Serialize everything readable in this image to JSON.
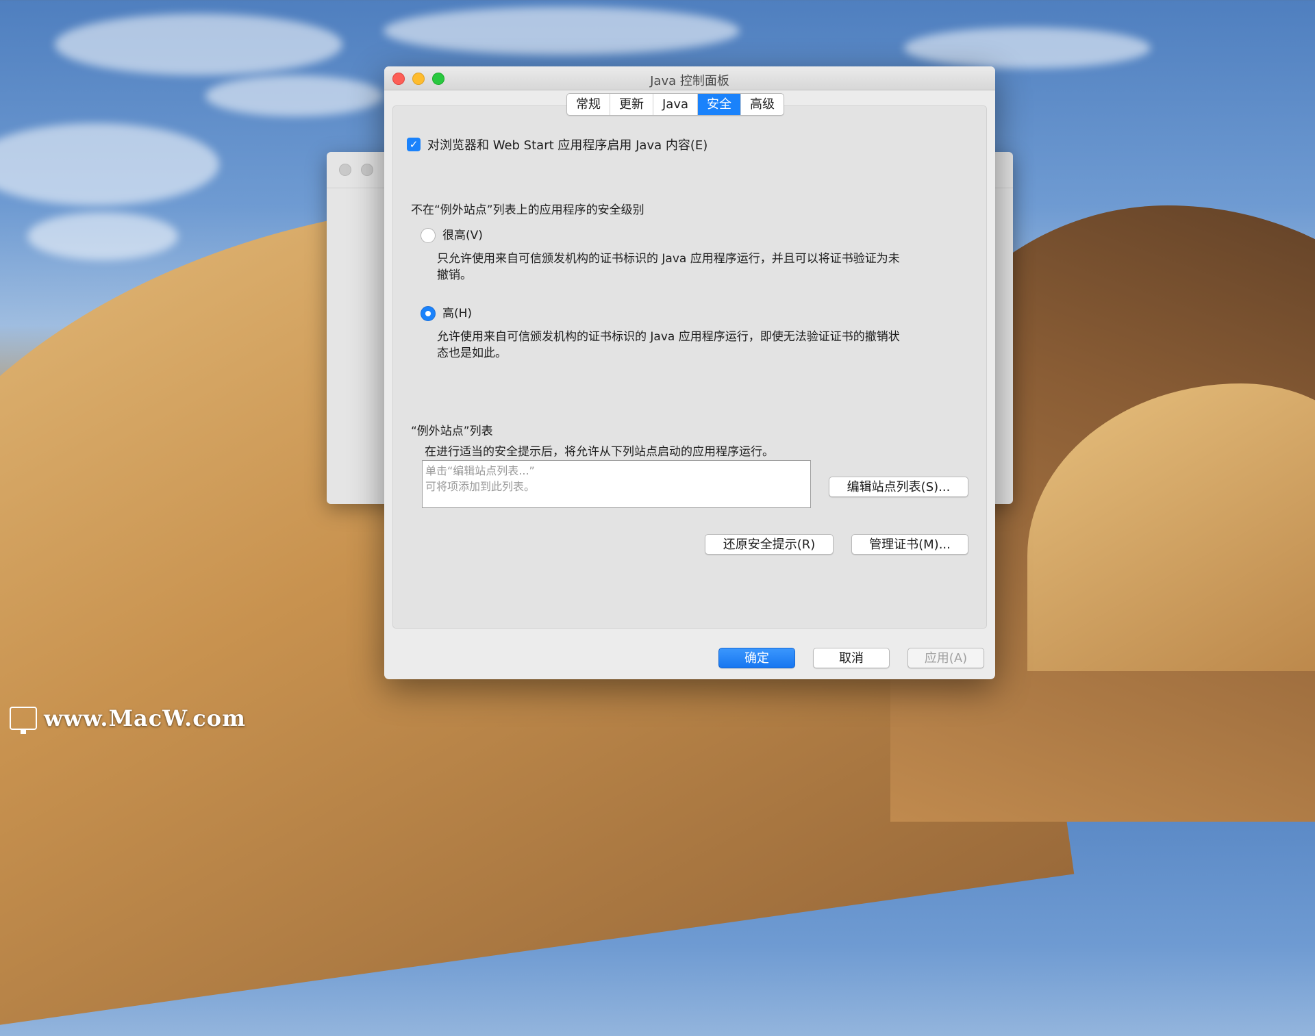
{
  "window": {
    "title": "Java 控制面板",
    "tabs": [
      {
        "label": "常规",
        "active": false
      },
      {
        "label": "更新",
        "active": false
      },
      {
        "label": "Java",
        "active": false
      },
      {
        "label": "安全",
        "active": true
      },
      {
        "label": "高级",
        "active": false
      }
    ]
  },
  "security": {
    "enable_checkbox_label": "对浏览器和 Web Start 应用程序启用 Java 内容(E)",
    "enable_checked": true,
    "level_heading": "不在“例外站点”列表上的应用程序的安全级别",
    "levels": [
      {
        "label": "很高(V)",
        "selected": false,
        "desc_line1": "只允许使用来自可信颁发机构的证书标识的 Java 应用程序运行，并且可以将证书验证为未",
        "desc_line2": "撤销。"
      },
      {
        "label": "高(H)",
        "selected": true,
        "desc_line1": "允许使用来自可信颁发机构的证书标识的 Java 应用程序运行，即使无法验证证书的撤销状",
        "desc_line2": "态也是如此。"
      }
    ],
    "exception_title": "“例外站点”列表",
    "exception_desc": "在进行适当的安全提示后，将允许从下列站点启动的应用程序运行。",
    "site_list_placeholder_line1": "单击“编辑站点列表...”",
    "site_list_placeholder_line2": "可将项添加到此列表。",
    "edit_sites_button": "编辑站点列表(S)...",
    "restore_prompts_button": "还原安全提示(R)",
    "manage_certs_button": "管理证书(M)..."
  },
  "footer": {
    "ok_button": "确定",
    "cancel_button": "取消",
    "apply_button": "应用(A)"
  },
  "watermark": {
    "text": "www.MacW.com"
  },
  "colors": {
    "accent": "#1a82fb",
    "close": "#fd5f57",
    "minimize": "#febc2e",
    "zoom": "#29c840"
  }
}
